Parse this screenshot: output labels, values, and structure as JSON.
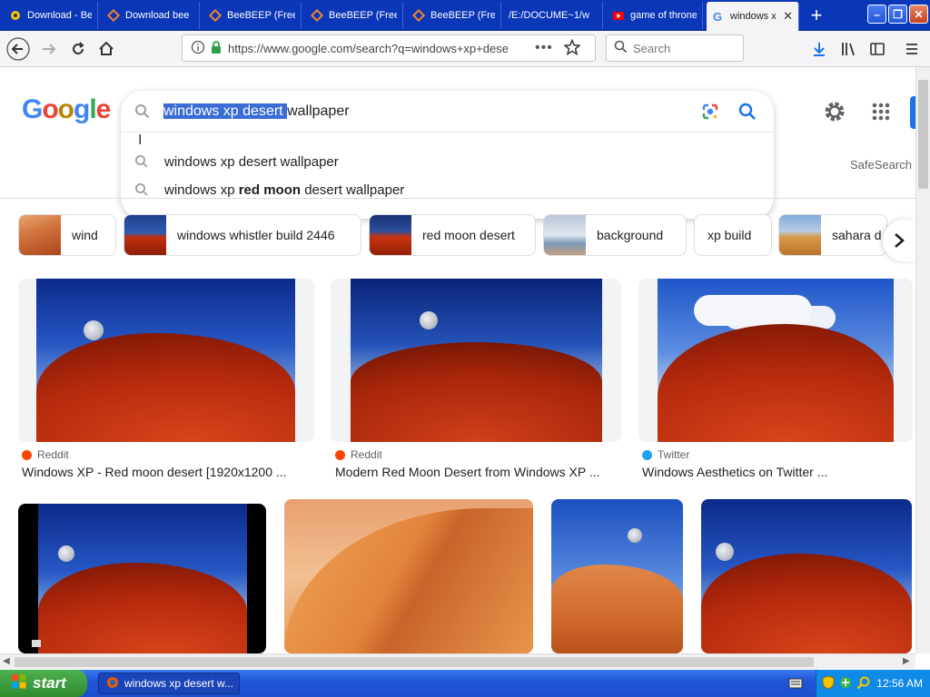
{
  "tabs": [
    {
      "title": "Download - Be",
      "icon": "beebeep-icon"
    },
    {
      "title": "Download bee",
      "icon": "softonic-icon"
    },
    {
      "title": "BeeBEEP (Free",
      "icon": "softonic-icon"
    },
    {
      "title": "BeeBEEP (Free",
      "icon": "softonic-icon"
    },
    {
      "title": "BeeBEEP (Free",
      "icon": "softonic-icon"
    },
    {
      "title": "/E:/DOCUME~1/w",
      "icon": "file-icon"
    },
    {
      "title": "game of throne",
      "icon": "youtube-icon"
    },
    {
      "title": "windows x",
      "icon": "google-icon",
      "active": true
    }
  ],
  "browser": {
    "url": "https://www.google.com/search?q=windows+xp+dese",
    "search_placeholder": "Search"
  },
  "google": {
    "logo": [
      "G",
      "o",
      "o",
      "g",
      "l",
      "e"
    ],
    "query_selected": "windows xp desert ",
    "query_rest": "wallpaper",
    "suggestions": [
      {
        "plain": "windows xp desert wallpaper",
        "bold": "",
        "after": ""
      },
      {
        "plain": "windows xp ",
        "bold": "red moon",
        "after": " desert wallpaper"
      }
    ],
    "safesearch": "SafeSearch"
  },
  "chips": [
    {
      "label": "wind"
    },
    {
      "label": "windows whistler build 2446"
    },
    {
      "label": "red moon desert"
    },
    {
      "label": "background"
    },
    {
      "label": "xp build"
    },
    {
      "label": "sahara d"
    }
  ],
  "results": [
    {
      "source": "Reddit",
      "title": "Windows XP - Red moon desert [1920x1200 ..."
    },
    {
      "source": "Reddit",
      "title": "Modern Red Moon Desert from Windows XP ..."
    },
    {
      "source": "Twitter",
      "title": "Windows Aesthetics on Twitter ..."
    }
  ],
  "taskbar": {
    "start": "start",
    "task": "windows xp desert w...",
    "clock": "12:56 AM"
  },
  "colors": {
    "xp_blue": "#0a36b8",
    "google_blue": "#1a73e8",
    "selection": "#3a6cd6",
    "dune_red": "#b8280a"
  }
}
